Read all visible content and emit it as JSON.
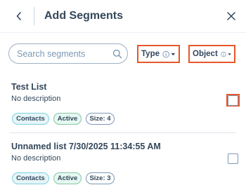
{
  "header": {
    "title": "Add Segments",
    "back_icon": "chevron-left-icon",
    "close_icon": "close-icon"
  },
  "search": {
    "placeholder": "Search segments",
    "value": "",
    "icon": "search-icon"
  },
  "filters": [
    {
      "label": "Type",
      "info_icon": "info-icon",
      "caret_icon": "caret-down-icon",
      "highlighted": true
    },
    {
      "label": "Object",
      "info_icon": "info-icon",
      "caret_icon": "caret-down-icon",
      "highlighted": true
    }
  ],
  "segments": [
    {
      "name": "Test List",
      "description": "No description",
      "tags": [
        "Contacts",
        "Active",
        "Size: 4"
      ],
      "checked": false,
      "checkbox_highlighted": true
    },
    {
      "name": "Unnamed list 7/30/2025 11:34:55 AM",
      "description": "No description",
      "tags": [
        "Contacts",
        "Active",
        "Size: 3"
      ],
      "checked": false,
      "checkbox_highlighted": false
    }
  ],
  "colors": {
    "text": "#33475b",
    "highlight": "#e8562a",
    "contacts_tag_bg": "#e5f5f8",
    "contacts_tag_border": "#7fd1de",
    "active_tag_bg": "#e5f8f1",
    "active_tag_border": "#86c5a5"
  }
}
